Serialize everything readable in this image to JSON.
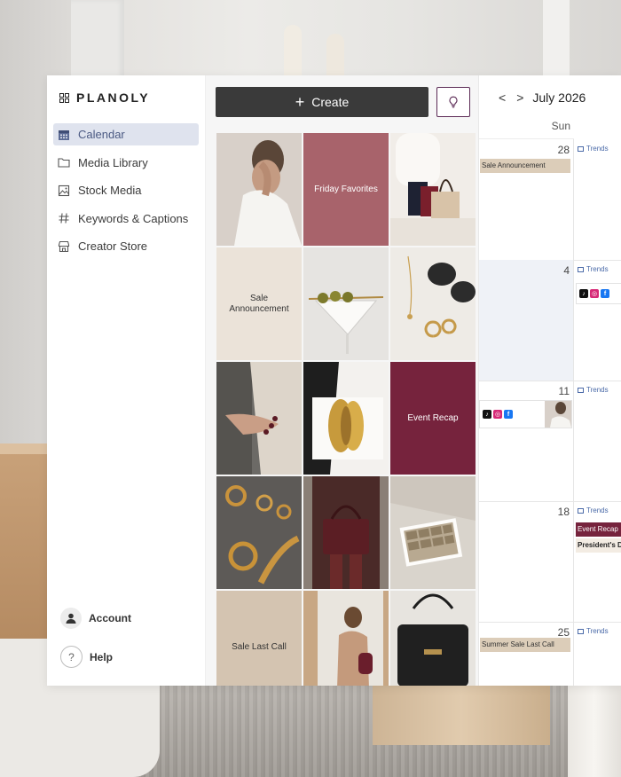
{
  "brand": {
    "name": "PLANOLY"
  },
  "sidebar": {
    "items": [
      {
        "label": "Calendar",
        "icon": "calendar-icon",
        "active": true
      },
      {
        "label": "Media Library",
        "icon": "folder-icon"
      },
      {
        "label": "Stock Media",
        "icon": "image-icon"
      },
      {
        "label": "Keywords & Captions",
        "icon": "hashtag-icon"
      },
      {
        "label": "Creator Store",
        "icon": "store-icon"
      }
    ],
    "account_label": "Account",
    "help_label": "Help",
    "help_glyph": "?"
  },
  "toolbar": {
    "create_label": "Create",
    "create_glyph": "+",
    "idea_icon": "lightbulb-icon"
  },
  "grid": {
    "tiles": [
      {
        "kind": "photo",
        "subject": "woman-hand-on-face"
      },
      {
        "kind": "text",
        "label": "Friday Favorites",
        "bg": "#a8636b",
        "fg": "#ffffff"
      },
      {
        "kind": "photo",
        "subject": "handbags"
      },
      {
        "kind": "text",
        "label": "Sale Announcement",
        "bg": "#ebe3d9",
        "fg": "#333333"
      },
      {
        "kind": "photo",
        "subject": "martini-olives"
      },
      {
        "kind": "photo",
        "subject": "sunglasses-jewelry"
      },
      {
        "kind": "photo",
        "subject": "manicure-hand"
      },
      {
        "kind": "photo",
        "subject": "gold-cuffs"
      },
      {
        "kind": "text",
        "label": "Event Recap",
        "bg": "#76233d",
        "fg": "#ffffff"
      },
      {
        "kind": "photo",
        "subject": "gold-hoops"
      },
      {
        "kind": "photo",
        "subject": "burgundy-bag-outfit"
      },
      {
        "kind": "photo",
        "subject": "jewelry-box"
      },
      {
        "kind": "text",
        "label": "Sale Last Call",
        "bg": "#d4c4b1",
        "fg": "#333333"
      },
      {
        "kind": "photo",
        "subject": "mirror-selfie"
      },
      {
        "kind": "photo",
        "subject": "black-handbag"
      }
    ]
  },
  "calendar": {
    "prev_glyph": "<",
    "next_glyph": ">",
    "month": "July 2026",
    "day_of_week": "Sun",
    "trends_label": "Trends",
    "weeks": [
      {
        "day": "28",
        "events": [
          {
            "label": "Sale Announcement",
            "bg": "#dccdb9",
            "fg": "#333333"
          }
        ]
      },
      {
        "day": "4",
        "events": [],
        "socials_next": [
          "tiktok",
          "instagram",
          "facebook"
        ]
      },
      {
        "day": "11",
        "events": [],
        "socials": [
          "tiktok",
          "instagram",
          "facebook"
        ]
      },
      {
        "day": "18",
        "events": [],
        "next_events": [
          {
            "label": "Event Recap",
            "bg": "#76233d",
            "fg": "#ffffff"
          },
          {
            "label": "President's D",
            "bg": "#f3ece3",
            "fg": "#222222"
          }
        ]
      },
      {
        "day": "25",
        "events": [
          {
            "label": "Summer Sale Last Call",
            "bg": "#dccdb9",
            "fg": "#333333"
          }
        ]
      }
    ]
  },
  "colors": {
    "accent": "#4b5a83",
    "active_bg": "#dfe3ee",
    "create_bg": "#3a3a3a",
    "idea_border": "#5b2a55",
    "tiktok": "#111111",
    "instagram": "#d62976",
    "facebook": "#1877f2"
  }
}
